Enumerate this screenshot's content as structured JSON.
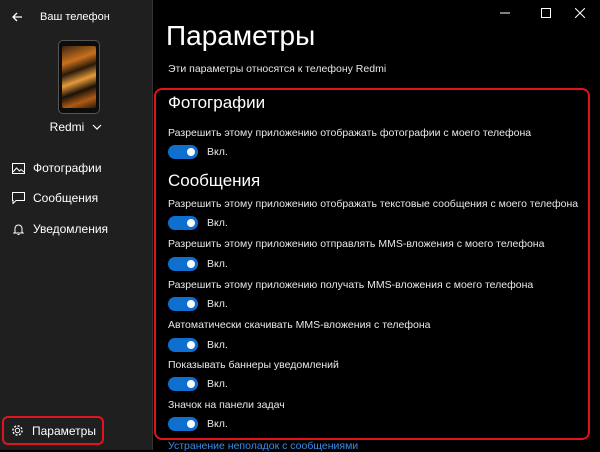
{
  "app": {
    "title": "Ваш телефон"
  },
  "device": {
    "name": "Redmi"
  },
  "nav": {
    "items": [
      {
        "label": "Фотографии",
        "icon": "photo-icon"
      },
      {
        "label": "Сообщения",
        "icon": "message-icon"
      },
      {
        "label": "Уведомления",
        "icon": "bell-icon"
      }
    ],
    "settings_label": "Параметры"
  },
  "page": {
    "title": "Параметры",
    "subtitle": "Эти параметры относятся к телефону Redmi"
  },
  "photos": {
    "title": "Фотографии",
    "settings": [
      {
        "label": "Разрешить этому приложению отображать фотографии с моего телефона",
        "state": "Вкл.",
        "on": true
      }
    ]
  },
  "messages": {
    "title": "Сообщения",
    "settings": [
      {
        "label": "Разрешить этому приложению отображать текстовые сообщения с моего телефона",
        "state": "Вкл.",
        "on": true
      },
      {
        "label": "Разрешить этому приложению отправлять MMS-вложения с моего телефона",
        "state": "Вкл.",
        "on": true
      },
      {
        "label": "Разрешить этому приложению получать MMS-вложения с моего телефона",
        "state": "Вкл.",
        "on": true
      },
      {
        "label": "Автоматически скачивать MMS-вложения с телефона",
        "state": "Вкл.",
        "on": true
      },
      {
        "label": "Показывать баннеры уведомлений",
        "state": "Вкл.",
        "on": true
      },
      {
        "label": "Значок на панели задач",
        "state": "Вкл.",
        "on": true
      }
    ]
  },
  "footer": {
    "link": "Устранение неполадок с сообщениями"
  },
  "colors": {
    "accent": "#0e6fcf",
    "highlight": "#e0151b",
    "sidebar": "#1f1f1f",
    "background": "#000000",
    "link": "#3a8ae6"
  }
}
